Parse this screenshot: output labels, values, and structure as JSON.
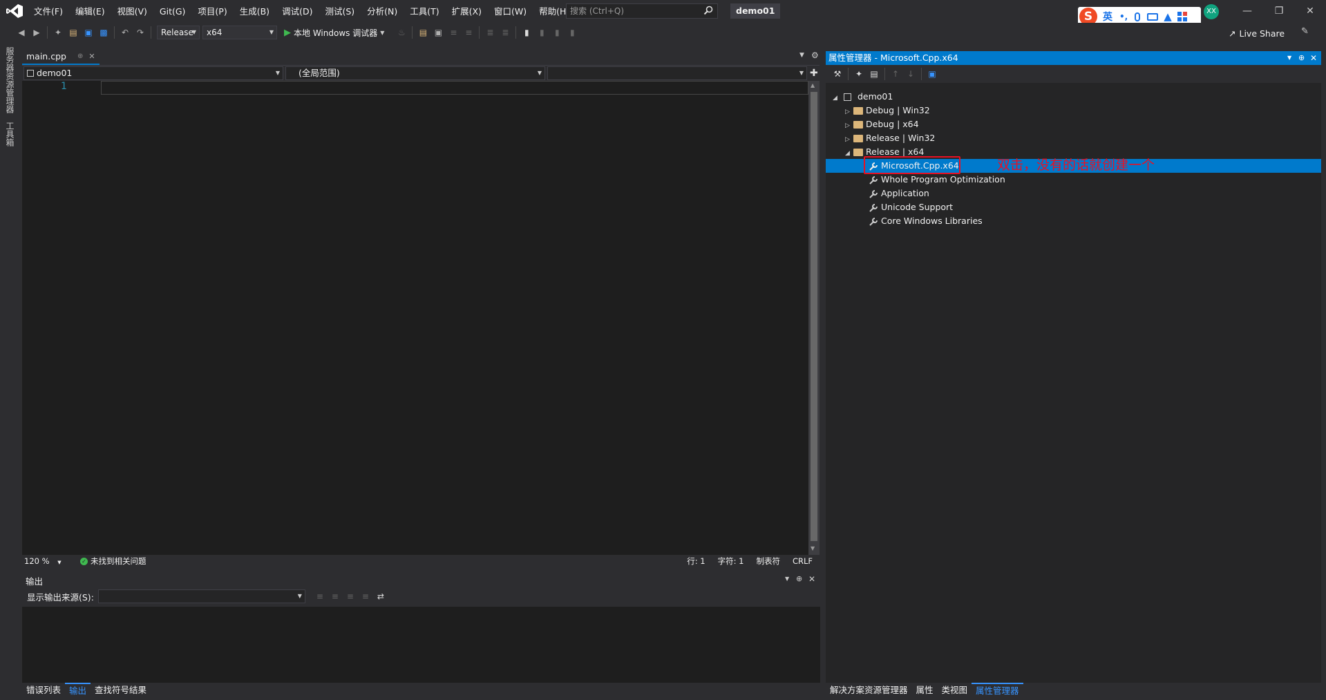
{
  "menu": [
    "文件(F)",
    "编辑(E)",
    "视图(V)",
    "Git(G)",
    "项目(P)",
    "生成(B)",
    "调试(D)",
    "测试(S)",
    "分析(N)",
    "工具(T)",
    "扩展(X)",
    "窗口(W)",
    "帮助(H)"
  ],
  "search": {
    "placeholder": "搜索 (Ctrl+Q)"
  },
  "solution_name": "demo01",
  "ime": {
    "lang": "英",
    "punct": "•,"
  },
  "avatar": "XX",
  "toolbar": {
    "config": "Release",
    "platform": "x64",
    "debugger": "本地 Windows 调试器"
  },
  "live_share": "Live Share",
  "left_strip": [
    "服务器资源管理器",
    "工具箱"
  ],
  "editor": {
    "tab": "main.cpp",
    "project_combo": "demo01",
    "scope_combo": "(全局范围)",
    "line_number": "1",
    "zoom": "120 %",
    "issues": "未找到相关问题",
    "line": "行: 1",
    "char": "字符: 1",
    "tabs": "制表符",
    "eol": "CRLF"
  },
  "output": {
    "title": "输出",
    "source_label": "显示输出来源(S):"
  },
  "bottom_tabs": [
    "错误列表",
    "输出",
    "查找符号结果"
  ],
  "property_manager": {
    "title": "属性管理器 - Microsoft.Cpp.x64",
    "tree": {
      "root": "demo01",
      "configs": [
        "Debug | Win32",
        "Debug | x64",
        "Release | Win32",
        "Release | x64"
      ],
      "sheets": [
        "Microsoft.Cpp.x64",
        "Whole Program Optimization",
        "Application",
        "Unicode Support",
        "Core Windows Libraries"
      ]
    },
    "annotation": "双击，没有的话就创建一个"
  },
  "right_bottom_tabs": [
    "解决方案资源管理器",
    "属性",
    "类视图",
    "属性管理器"
  ]
}
